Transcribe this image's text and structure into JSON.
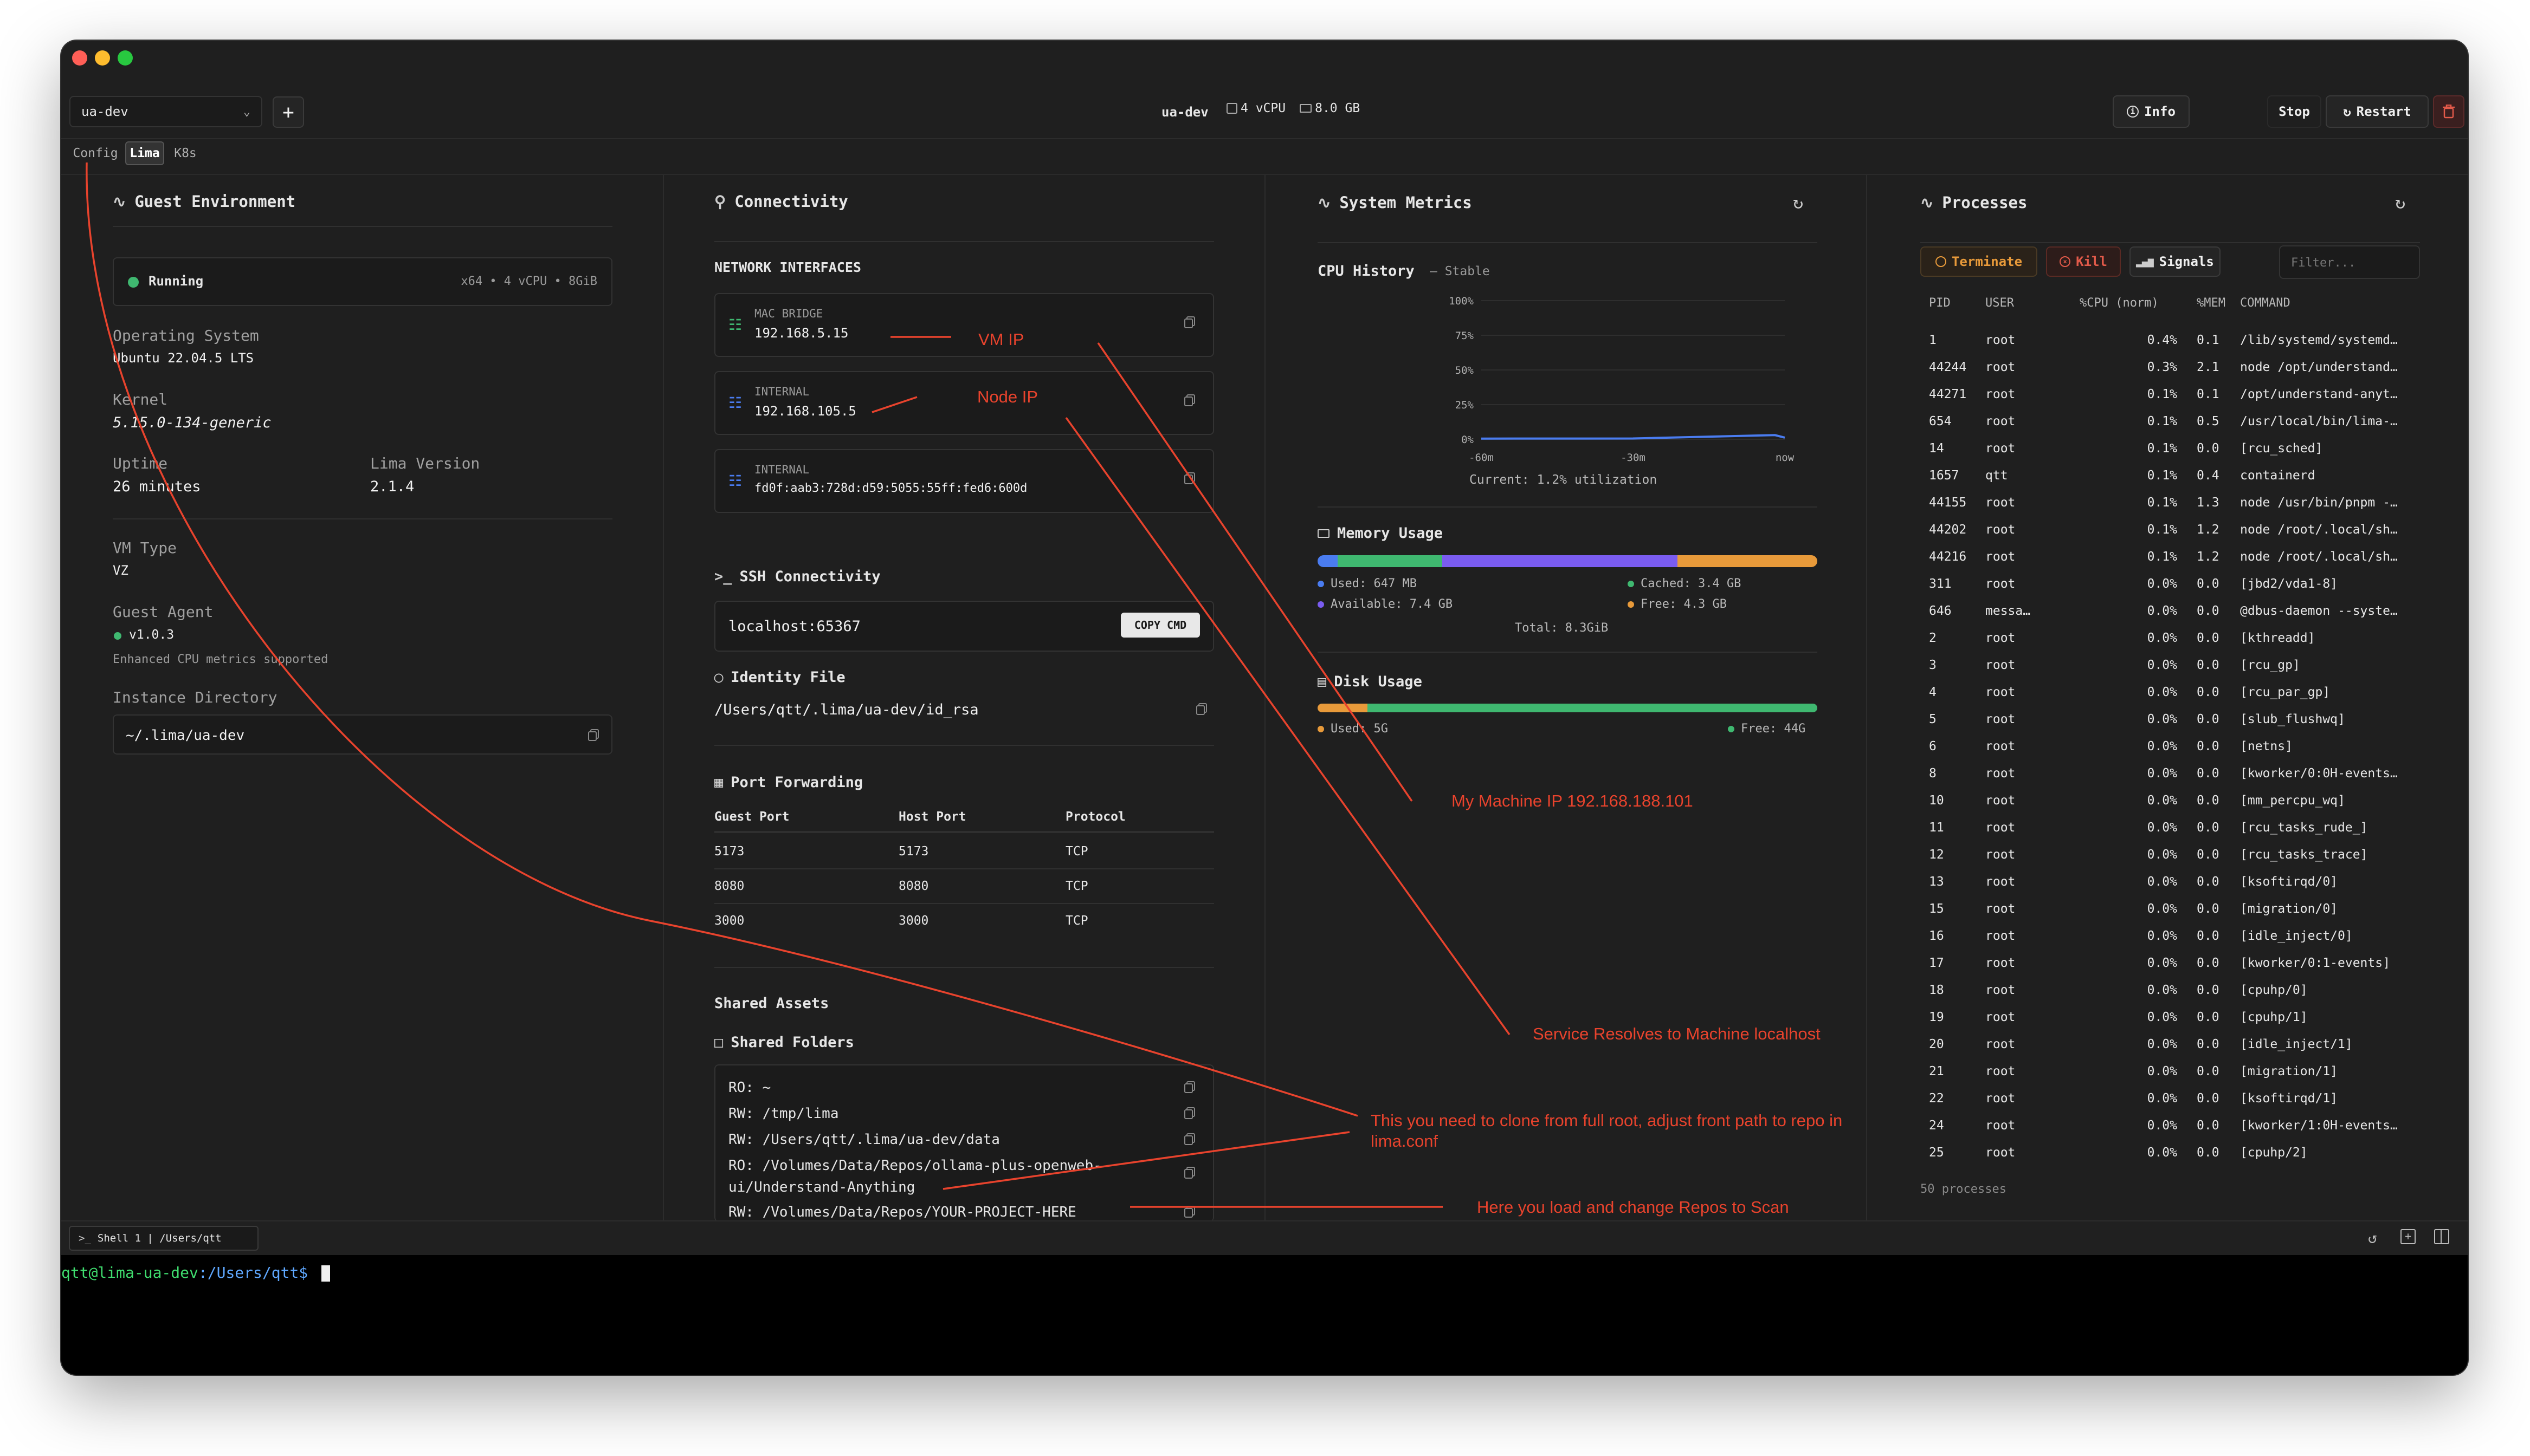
{
  "header": {
    "instance_select": "ua-dev",
    "add_label": "+",
    "instance_name": "ua-dev",
    "vcpu": "4 vCPU",
    "memory": "8.0 GB",
    "info_label": "Info",
    "stop_label": "Stop",
    "restart_label": "Restart"
  },
  "tabs": [
    {
      "label": "Config"
    },
    {
      "label": "Lima"
    },
    {
      "label": "K8s"
    }
  ],
  "guest": {
    "title": "Guest Environment",
    "status": "Running",
    "status_spec": "x64 • 4 vCPU • 8GiB",
    "os_label": "Operating System",
    "os_value": "Ubuntu 22.04.5 LTS",
    "kernel_label": "Kernel",
    "kernel_value": "5.15.0-134-generic",
    "uptime_label": "Uptime",
    "uptime_value": "26 minutes",
    "lima_label": "Lima Version",
    "lima_value": "2.1.4",
    "vmtype_label": "VM Type",
    "vmtype_value": "VZ",
    "agent_label": "Guest Agent",
    "agent_value": "v1.0.3",
    "agent_note": "Enhanced CPU metrics supported",
    "dir_label": "Instance Directory",
    "dir_value": "~/.lima/ua-dev"
  },
  "connectivity": {
    "title": "Connectivity",
    "net_title": "NETWORK INTERFACES",
    "interfaces": [
      {
        "kind": "MAC BRIDGE",
        "addr": "192.168.5.15"
      },
      {
        "kind": "INTERNAL",
        "addr": "192.168.105.5"
      },
      {
        "kind": "INTERNAL",
        "addr": "fd0f:aab3:728d:d59:5055:55ff:fed6:600d"
      }
    ],
    "ssh_title": "SSH Connectivity",
    "ssh_value": "localhost:65367",
    "copy_cmd": "COPY CMD",
    "identity_title": "Identity File",
    "identity_value": "/Users/qtt/.lima/ua-dev/id_rsa",
    "pf_title": "Port Forwarding",
    "pf_headers": [
      "Guest Port",
      "Host Port",
      "Protocol"
    ],
    "pf_rows": [
      [
        "5173",
        "5173",
        "TCP"
      ],
      [
        "8080",
        "8080",
        "TCP"
      ],
      [
        "3000",
        "3000",
        "TCP"
      ]
    ],
    "assets_title": "Shared Assets",
    "folders_title": "Shared Folders",
    "folders": [
      "RO: ~",
      "RW: /tmp/lima",
      "RW: /Users/qtt/.lima/ua-dev/data",
      "RO: /Volumes/Data/Repos/ollama-plus-openweb-",
      "ui/Understand-Anything",
      "RW: /Volumes/Data/Repos/YOUR-PROJECT-HERE"
    ]
  },
  "metrics": {
    "title": "System Metrics",
    "cpu_title": "CPU History",
    "cpu_state": "— Stable",
    "y_ticks": [
      "100%",
      "75%",
      "50%",
      "25%",
      "0%"
    ],
    "x_ticks": [
      "-60m",
      "-30m",
      "now"
    ],
    "cpu_current": "Current: 1.2% utilization",
    "mem_title": "Memory Usage",
    "mem_used": "Used: 647 MB",
    "mem_cached": "Cached: 3.4 GB",
    "mem_avail": "Available: 7.4 GB",
    "mem_free": "Free: 4.3 GB",
    "mem_total": "Total: 8.3GiB",
    "mem_fractions": {
      "used": 0.04,
      "green": 0.21,
      "purple": 0.47,
      "orange": 0.28
    },
    "disk_title": "Disk Usage",
    "disk_used": "Used: 5G",
    "disk_free": "Free: 44G",
    "disk_fraction_used": 0.1
  },
  "chart_data": {
    "type": "line",
    "title": "CPU History",
    "x": [
      "-60m",
      "-30m",
      "now"
    ],
    "series": [
      {
        "values": [
          0.5,
          0.6,
          1.2
        ]
      }
    ],
    "ylim": [
      0,
      100
    ]
  },
  "processes": {
    "title": "Processes",
    "terminate": "Terminate",
    "kill": "Kill",
    "signals": "Signals",
    "filter_placeholder": "Filter...",
    "headers": [
      "PID",
      "USER",
      "%CPU (norm)",
      "%MEM",
      "COMMAND"
    ],
    "rows": [
      [
        "1",
        "root",
        "0.4%",
        "0.1",
        "/lib/systemd/systemd…"
      ],
      [
        "44244",
        "root",
        "0.3%",
        "2.1",
        "node /opt/understand…"
      ],
      [
        "44271",
        "root",
        "0.1%",
        "0.1",
        "/opt/understand-anyt…"
      ],
      [
        "654",
        "root",
        "0.1%",
        "0.5",
        "/usr/local/bin/lima-…"
      ],
      [
        "14",
        "root",
        "0.1%",
        "0.0",
        "[rcu_sched]"
      ],
      [
        "1657",
        "qtt",
        "0.1%",
        "0.4",
        "containerd"
      ],
      [
        "44155",
        "root",
        "0.1%",
        "1.3",
        "node /usr/bin/pnpm -…"
      ],
      [
        "44202",
        "root",
        "0.1%",
        "1.2",
        "node /root/.local/sh…"
      ],
      [
        "44216",
        "root",
        "0.1%",
        "1.2",
        "node /root/.local/sh…"
      ],
      [
        "311",
        "root",
        "0.0%",
        "0.0",
        "[jbd2/vda1-8]"
      ],
      [
        "646",
        "messa…",
        "0.0%",
        "0.0",
        "@dbus-daemon --syste…"
      ],
      [
        "2",
        "root",
        "0.0%",
        "0.0",
        "[kthreadd]"
      ],
      [
        "3",
        "root",
        "0.0%",
        "0.0",
        "[rcu_gp]"
      ],
      [
        "4",
        "root",
        "0.0%",
        "0.0",
        "[rcu_par_gp]"
      ],
      [
        "5",
        "root",
        "0.0%",
        "0.0",
        "[slub_flushwq]"
      ],
      [
        "6",
        "root",
        "0.0%",
        "0.0",
        "[netns]"
      ],
      [
        "8",
        "root",
        "0.0%",
        "0.0",
        "[kworker/0:0H-events…"
      ],
      [
        "10",
        "root",
        "0.0%",
        "0.0",
        "[mm_percpu_wq]"
      ],
      [
        "11",
        "root",
        "0.0%",
        "0.0",
        "[rcu_tasks_rude_]"
      ],
      [
        "12",
        "root",
        "0.0%",
        "0.0",
        "[rcu_tasks_trace]"
      ],
      [
        "13",
        "root",
        "0.0%",
        "0.0",
        "[ksoftirqd/0]"
      ],
      [
        "15",
        "root",
        "0.0%",
        "0.0",
        "[migration/0]"
      ],
      [
        "16",
        "root",
        "0.0%",
        "0.0",
        "[idle_inject/0]"
      ],
      [
        "17",
        "root",
        "0.0%",
        "0.0",
        "[kworker/0:1-events]"
      ],
      [
        "18",
        "root",
        "0.0%",
        "0.0",
        "[cpuhp/0]"
      ],
      [
        "19",
        "root",
        "0.0%",
        "0.0",
        "[cpuhp/1]"
      ],
      [
        "20",
        "root",
        "0.0%",
        "0.0",
        "[idle_inject/1]"
      ],
      [
        "21",
        "root",
        "0.0%",
        "0.0",
        "[migration/1]"
      ],
      [
        "22",
        "root",
        "0.0%",
        "0.0",
        "[ksoftirqd/1]"
      ],
      [
        "24",
        "root",
        "0.0%",
        "0.0",
        "[kworker/1:0H-events…"
      ],
      [
        "25",
        "root",
        "0.0%",
        "0.0",
        "[cpuhp/2]"
      ]
    ],
    "count": "50 processes"
  },
  "terminal": {
    "tab_label": "Shell 1 | /Users/qtt",
    "prompt_user": "qtt@lima-ua-dev",
    "prompt_path": ":/Users/qtt$"
  },
  "annotations": {
    "vm_ip": "VM IP",
    "node_ip": "Node IP",
    "machine_ip": "My Machine IP 192.168.188.101",
    "service": "Service Resolves to Machine localhost",
    "clone": "This you need to clone from full root, adjust front path to repo in lima.conf",
    "repos": "Here you load and change Repos to Scan"
  },
  "colors": {
    "accent_green": "#3fb870",
    "accent_orange": "#e89a3a",
    "accent_purple": "#7a5cf0",
    "accent_blue": "#4a7cf0",
    "annotation_red": "#e8432d",
    "kill_red": "#e25a4a"
  }
}
